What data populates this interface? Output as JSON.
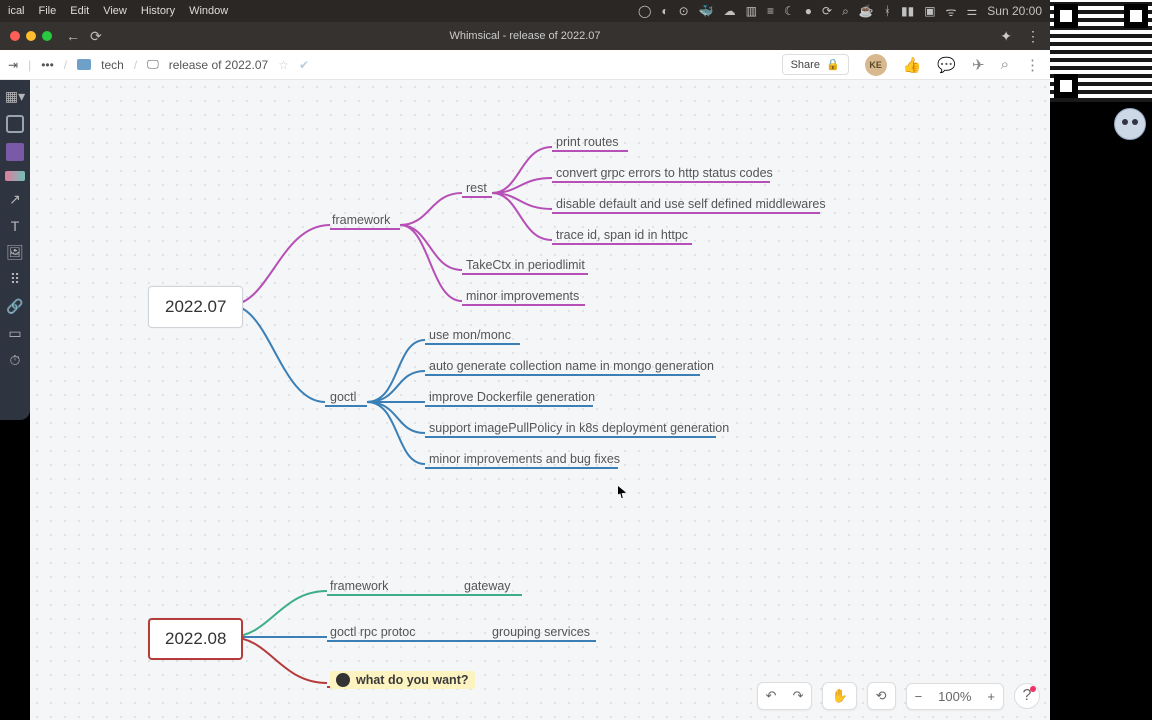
{
  "menubar": {
    "app": "ical",
    "items": [
      "File",
      "Edit",
      "View",
      "History",
      "Window"
    ],
    "clock": "Sun 20:00"
  },
  "browser": {
    "tab_title": "Whimsical - release of 2022.07"
  },
  "breadcrumb": {
    "folder": "tech",
    "doc": "release of 2022.07"
  },
  "topbar": {
    "share_label": "Share",
    "avatar_initials": "KE"
  },
  "mindmap": {
    "tree1": {
      "root": "2022.07",
      "framework": {
        "label": "framework",
        "rest": {
          "label": "rest",
          "leaves": [
            "print routes",
            "convert grpc errors to http status codes",
            "disable default and use self defined middlewares",
            "trace id, span id in httpc"
          ]
        },
        "other": [
          "TakeCtx in periodlimit",
          "minor improvements"
        ]
      },
      "goctl": {
        "label": "goctl",
        "leaves": [
          "use mon/monc",
          "auto generate collection name in mongo generation",
          "improve Dockerfile generation",
          "support imagePullPolicy in k8s deployment generation",
          "minor improvements and bug fixes"
        ]
      }
    },
    "tree2": {
      "root": "2022.08",
      "framework": {
        "label": "framework",
        "leaf": "gateway"
      },
      "goctl_rpc": {
        "label": "goctl rpc protoc",
        "leaf": "grouping services"
      },
      "want": "what do you want?"
    }
  },
  "zoom": {
    "value": "100%"
  },
  "colors": {
    "purple": "#b64fb6",
    "blue": "#3a7fb5",
    "green": "#3fae86",
    "red": "#b63b3b"
  }
}
